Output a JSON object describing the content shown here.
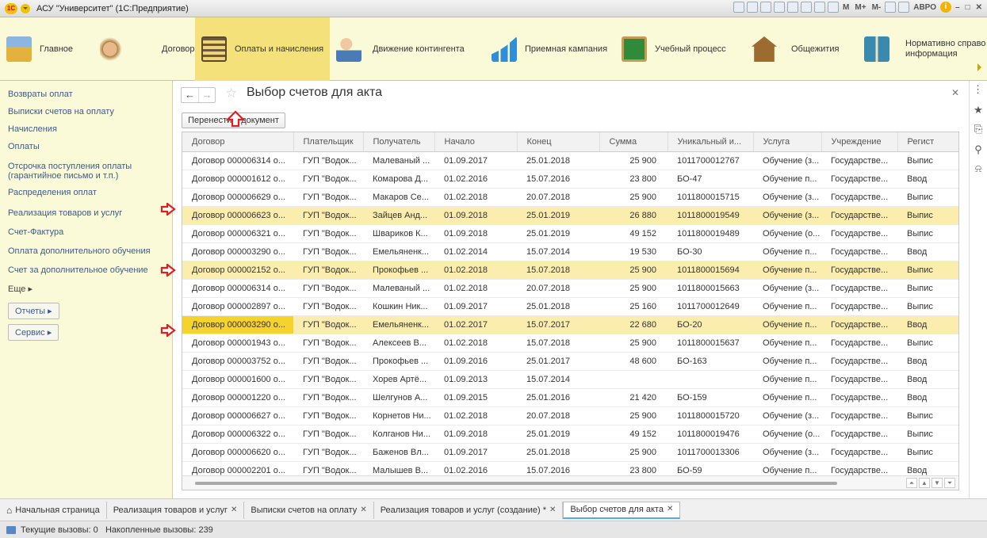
{
  "window": {
    "title": "АСУ \"Университет\" (1С:Предприятие)",
    "toolbar_texts": [
      "M",
      "M+",
      "M-",
      "АВРО"
    ]
  },
  "sections": [
    {
      "label": "Главное",
      "icon": "desk-icon",
      "color": "#e3b23c"
    },
    {
      "label": "Договоры",
      "icon": "handshake-icon",
      "color": "#b07a3e"
    },
    {
      "label": "Оплаты и начисления",
      "icon": "abacus-icon",
      "color": "#6b5a3a",
      "active": true
    },
    {
      "label": "Движение контингента",
      "icon": "person-computer-icon",
      "color": "#4a7bb5"
    },
    {
      "label": "Приемная кампания",
      "icon": "chart-growth-icon",
      "color": "#2e8fd8"
    },
    {
      "label": "Учебный процесс",
      "icon": "blackboard-icon",
      "color": "#2f8a3a"
    },
    {
      "label": "Общежития",
      "icon": "house-icon",
      "color": "#9b6b2f"
    },
    {
      "label": "Нормативно справо",
      "label2": "информация",
      "icon": "book-icon",
      "color": "#3a8ab0"
    }
  ],
  "leftnav": {
    "items": [
      "Возвраты оплат",
      "Выписки счетов на оплату",
      "Начисления",
      "Оплаты",
      "Отсрочка поступления оплаты|(гарантийное письмо и т.п.)",
      "Распределения оплат",
      "Реализация товаров и услуг",
      "Счет-Фактура",
      "Оплата дополнительного обучения",
      "Счет за дополнительное обучение",
      "Еще ▸"
    ],
    "buttons": [
      "Отчеты ▸",
      "Сервис ▸"
    ]
  },
  "form": {
    "title": "Выбор счетов для акта",
    "transfer_button": "Перенести в документ",
    "columns": [
      "Договор",
      "Плательщик",
      "Получатель",
      "Начало",
      "Конец",
      "Сумма",
      "Уникальный и...",
      "Услуга",
      "Учреждение",
      "Регист"
    ],
    "rows": [
      {
        "c": [
          "Договор 000006314 о...",
          "ГУП \"Водок...",
          "Малеваный ...",
          "01.09.2017",
          "25.01.2018",
          "25 900",
          "1011700012767",
          "Обучение (з...",
          "Государстве...",
          "Выпис"
        ]
      },
      {
        "c": [
          "Договор 000001612 о...",
          "ГУП \"Водок...",
          "Комарова Д...",
          "01.02.2016",
          "15.07.2016",
          "23 800",
          "БО-47",
          "Обучение п...",
          "Государстве...",
          "Ввод"
        ]
      },
      {
        "c": [
          "Договор 000006629 о...",
          "ГУП \"Водок...",
          "Макаров Се...",
          "01.02.2018",
          "20.07.2018",
          "25 900",
          "1011800015715",
          "Обучение (з...",
          "Государстве...",
          "Выпис"
        ]
      },
      {
        "c": [
          "Договор 000006623 о...",
          "ГУП \"Водок...",
          "Зайцев Анд...",
          "01.09.2018",
          "25.01.2019",
          "26 880",
          "1011800019549",
          "Обучение (з...",
          "Государстве...",
          "Выпис"
        ],
        "hl": true
      },
      {
        "c": [
          "Договор 000006321 о...",
          "ГУП \"Водок...",
          "Швариков К...",
          "01.09.2018",
          "25.01.2019",
          "49 152",
          "1011800019489",
          "Обучение (о...",
          "Государстве...",
          "Выпис"
        ]
      },
      {
        "c": [
          "Договор 000003290 о...",
          "ГУП \"Водок...",
          "Емельяненк...",
          "01.02.2014",
          "15.07.2014",
          "19 530",
          "БО-30",
          "Обучение п...",
          "Государстве...",
          "Ввод"
        ]
      },
      {
        "c": [
          "Договор 000002152 о...",
          "ГУП \"Водок...",
          "Прокофьев ...",
          "01.02.2018",
          "15.07.2018",
          "25 900",
          "1011800015694",
          "Обучение п...",
          "Государстве...",
          "Выпис"
        ],
        "hl": true
      },
      {
        "c": [
          "Договор 000006314 о...",
          "ГУП \"Водок...",
          "Малеваный ...",
          "01.02.2018",
          "20.07.2018",
          "25 900",
          "1011800015663",
          "Обучение (з...",
          "Государстве...",
          "Выпис"
        ]
      },
      {
        "c": [
          "Договор 000002897 о...",
          "ГУП \"Водок...",
          "Кошкин Ник...",
          "01.09.2017",
          "25.01.2018",
          "25 160",
          "1011700012649",
          "Обучение п...",
          "Государстве...",
          "Выпис"
        ]
      },
      {
        "c": [
          "Договор 000003290 о...",
          "ГУП \"Водок...",
          "Емельяненк...",
          "01.02.2017",
          "15.07.2017",
          "22 680",
          "БО-20",
          "Обучение п...",
          "Государстве...",
          "Ввод"
        ],
        "hl": true,
        "current": true
      },
      {
        "c": [
          "Договор 000001943 о...",
          "ГУП \"Водок...",
          "Алексеев В...",
          "01.02.2018",
          "15.07.2018",
          "25 900",
          "1011800015637",
          "Обучение п...",
          "Государстве...",
          "Выпис"
        ]
      },
      {
        "c": [
          "Договор 000003752 о...",
          "ГУП \"Водок...",
          "Прокофьев ...",
          "01.09.2016",
          "25.01.2017",
          "48 600",
          "БО-163",
          "Обучение п...",
          "Государстве...",
          "Ввод"
        ]
      },
      {
        "c": [
          "Договор 000001600 о...",
          "ГУП \"Водок...",
          "Хорев Артё...",
          "01.09.2013",
          "15.07.2014",
          "",
          "",
          "Обучение п...",
          "Государстве...",
          "Ввод"
        ]
      },
      {
        "c": [
          "Договор 000001220 о...",
          "ГУП \"Водок...",
          "Шелгунов А...",
          "01.09.2015",
          "25.01.2016",
          "21 420",
          "БО-159",
          "Обучение п...",
          "Государстве...",
          "Ввод"
        ]
      },
      {
        "c": [
          "Договор 000006627 о...",
          "ГУП \"Водок...",
          "Корнетов Ни...",
          "01.02.2018",
          "20.07.2018",
          "25 900",
          "1011800015720",
          "Обучение (з...",
          "Государстве...",
          "Выпис"
        ]
      },
      {
        "c": [
          "Договор 000006322 о...",
          "ГУП \"Водок...",
          "Колганов Ни...",
          "01.09.2018",
          "25.01.2019",
          "49 152",
          "1011800019476",
          "Обучение (о...",
          "Государстве...",
          "Выпис"
        ]
      },
      {
        "c": [
          "Договор 000006620 о...",
          "ГУП \"Водок...",
          "Баженов Вл...",
          "01.09.2017",
          "25.01.2018",
          "25 900",
          "1011700013306",
          "Обучение (з...",
          "Государстве...",
          "Выпис"
        ]
      },
      {
        "c": [
          "Договор 000002201 о...",
          "ГУП \"Водок...",
          "Малышев В...",
          "01.02.2016",
          "15.07.2016",
          "23 800",
          "БО-59",
          "Обучение п...",
          "Государстве...",
          "Ввод"
        ]
      }
    ]
  },
  "tabs": [
    {
      "label": "Начальная страница",
      "home": true
    },
    {
      "label": "Реализация товаров и услуг"
    },
    {
      "label": "Выписки счетов на оплату"
    },
    {
      "label": "Реализация товаров и услуг (создание) *"
    },
    {
      "label": "Выбор счетов для акта",
      "active": true
    }
  ],
  "status": {
    "text": "Текущие вызовы: 0   Накопленные вызовы: 239"
  },
  "colors": {
    "accent_yellow": "#f5e17a",
    "highlight_row": "#fbedad",
    "current_cell": "#f6d22c",
    "arrow_red": "#e02020"
  }
}
